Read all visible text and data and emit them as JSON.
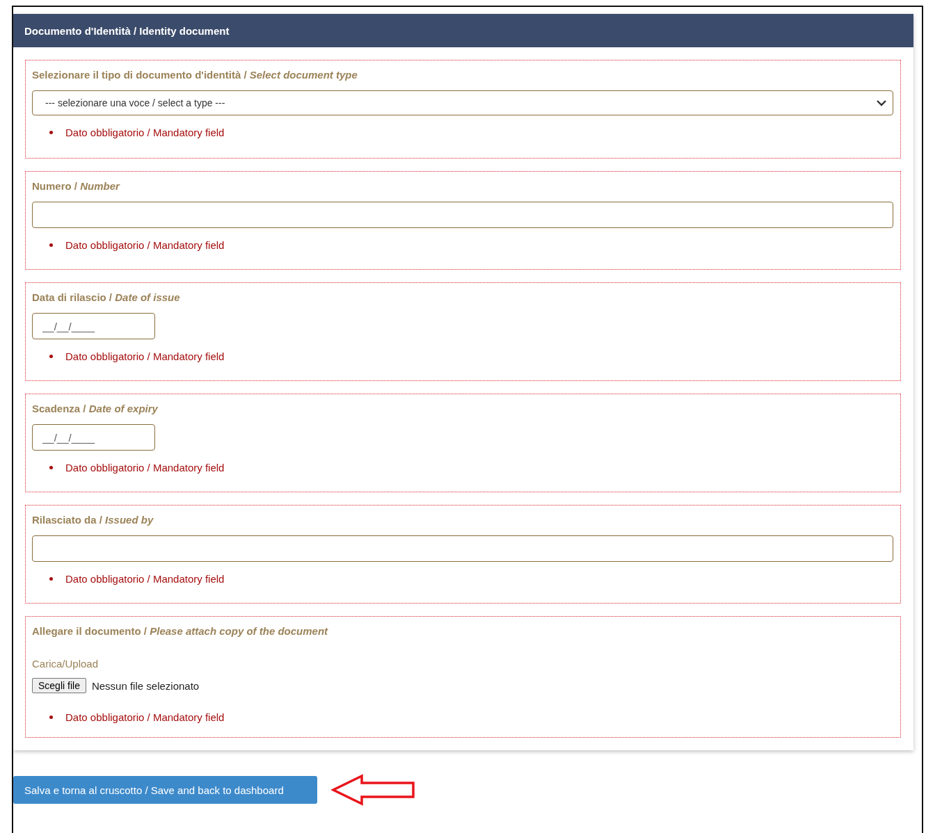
{
  "panel": {
    "title": "Documento d'Identità / Identity document"
  },
  "sections": [
    {
      "label": "Selezionare il tipo di documento d'identità / *Select document type*",
      "kind": "select",
      "value": "--- selezionare una voce / select a type ---",
      "error": "Dato obbligatorio / Mandatory field"
    },
    {
      "label": "Numero / *Number*",
      "kind": "text",
      "error": "Dato obbligatorio / Mandatory field"
    },
    {
      "label": "Data di rilascio / *Date of issue*",
      "kind": "date",
      "placeholder": "__/__/____",
      "error": "Dato obbligatorio / Mandatory field"
    },
    {
      "label": "Scadenza / *Date of expiry*",
      "kind": "date",
      "placeholder": "__/__/____",
      "error": "Dato obbligatorio / Mandatory field"
    },
    {
      "label": "Rilasciato da / *Issued by*",
      "kind": "text",
      "error": "Dato obbligatorio / Mandatory field"
    },
    {
      "label": "Allegare il documento / *Please attach copy of the document*",
      "kind": "file",
      "sublabel": "Carica/Upload",
      "button": "Scegli file",
      "status": "Nessun file selezionato",
      "error": "Dato obbligatorio / Mandatory field"
    }
  ],
  "save_button": "Salva e torna al cruscotto / Save and back to dashboard"
}
